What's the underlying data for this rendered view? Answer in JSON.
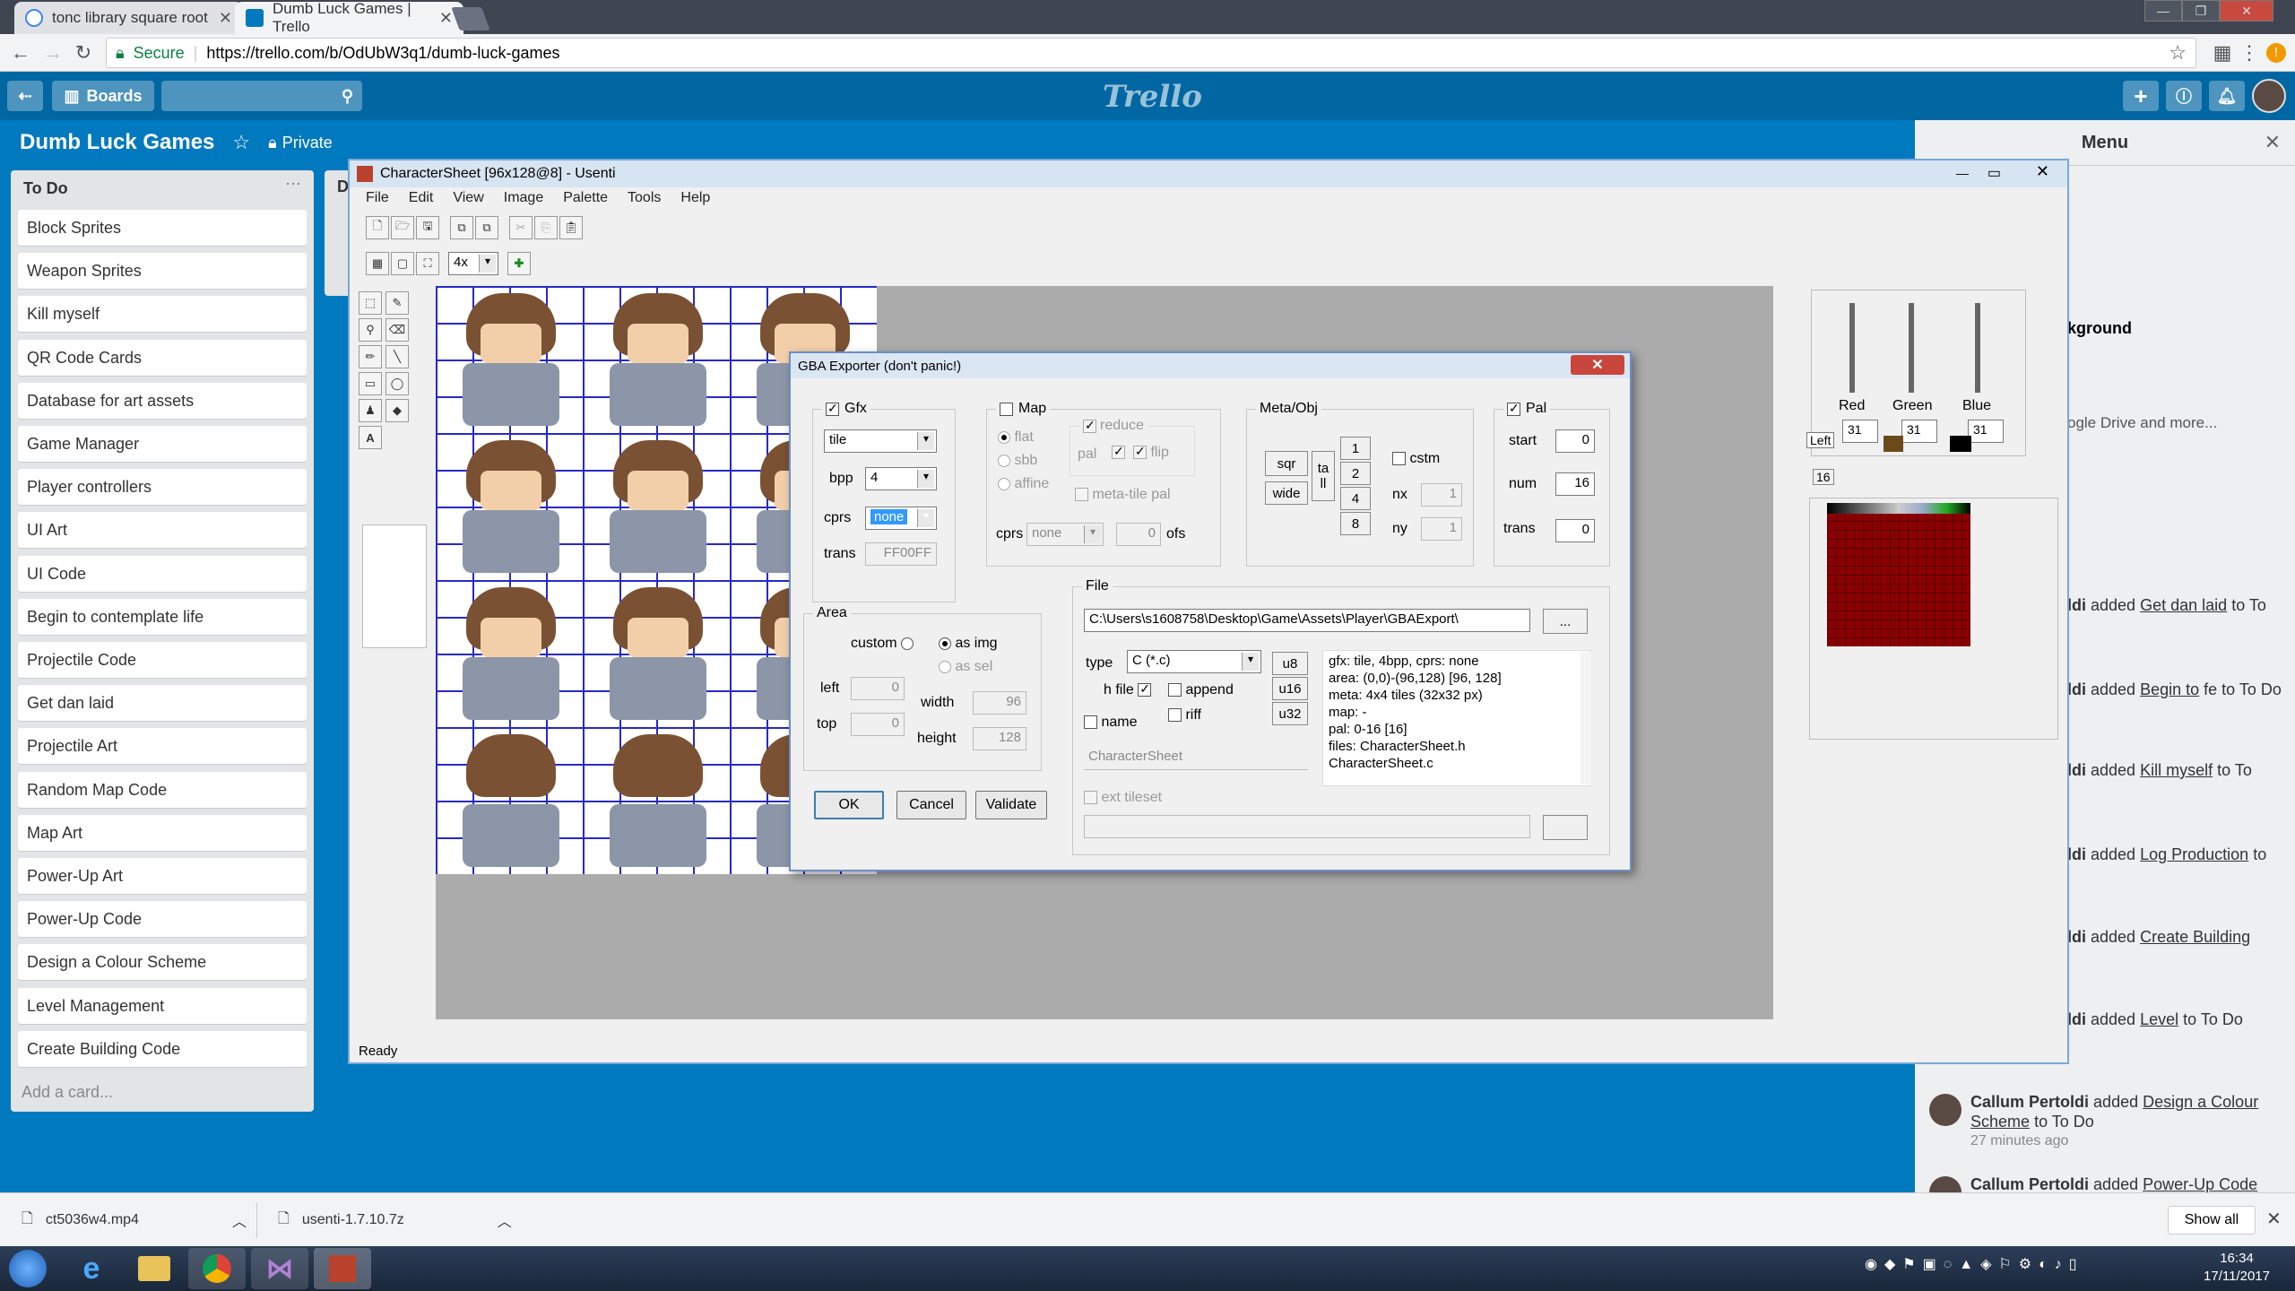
{
  "browser": {
    "tabs": [
      {
        "title": "tonc library square root",
        "active": false
      },
      {
        "title": "Dumb Luck Games | Trello",
        "active": true
      }
    ],
    "secure_label": "Secure",
    "url": "https://trello.com/b/OdUbW3q1/dumb-luck-games"
  },
  "trello": {
    "boards_label": "Boards",
    "logo": "Trello",
    "board_title": "Dumb Luck Games",
    "visibility": "Private",
    "list": {
      "title": "To Do",
      "cards": [
        "Block Sprites",
        "Weapon Sprites",
        "Kill myself",
        "QR Code Cards",
        "Database for art assets",
        "Game Manager",
        "Player controllers",
        "UI Art",
        "UI Code",
        "Begin to contemplate life",
        "Projectile Code",
        "Get dan laid",
        "Projectile Art",
        "Random Map Code",
        "Map Art",
        "Power-Up Art",
        "Power-Up Code",
        "Design a Colour Scheme",
        "Level Management",
        "Create Building Code"
      ],
      "add_card": "Add a card..."
    },
    "list2_initial": "D",
    "menu": {
      "title": "Menu",
      "background_frag": "kground",
      "drive_frag": "ogle Drive and more...",
      "activities": [
        {
          "who": "ldi",
          "verb": "added",
          "card": "Get dan laid",
          "rest": "to To"
        },
        {
          "who": "ldi",
          "verb": "added",
          "card": "Begin to",
          "rest": "fe to To Do"
        },
        {
          "who": "ldi",
          "verb": "added",
          "card": "Kill myself",
          "rest": "to To"
        },
        {
          "who": "ldi",
          "verb": "added",
          "card": "Log Production",
          "rest": "to"
        },
        {
          "who": "ldi",
          "verb": "added",
          "card": "Create Building",
          "rest": ""
        },
        {
          "who": "ldi",
          "verb": "added",
          "card": "Level",
          "rest": "to To Do"
        }
      ],
      "full_activities": [
        {
          "who": "Callum Pertoldi",
          "verb": "added",
          "card": "Design a Colour Scheme",
          "rest": "to To Do",
          "time": "27 minutes ago"
        },
        {
          "who": "Callum Pertoldi",
          "verb": "added",
          "card": "Power-Up Code",
          "rest": "",
          "time": ""
        }
      ]
    }
  },
  "usenti": {
    "title": "CharacterSheet [96x128@8] - Usenti",
    "menus": [
      "File",
      "Edit",
      "View",
      "Image",
      "Palette",
      "Tools",
      "Help"
    ],
    "zoom": "4x",
    "status": "Ready",
    "palette": {
      "labels": [
        "Red",
        "Green",
        "Blue"
      ],
      "values": [
        "31",
        "31",
        "31"
      ],
      "left_label": "Left",
      "count": "16"
    }
  },
  "gba": {
    "title": "GBA Exporter (don't panic!)",
    "gfx": {
      "label": "Gfx",
      "mode": "tile",
      "bpp_label": "bpp",
      "bpp": "4",
      "cprs_label": "cprs",
      "cprs": "none",
      "trans_label": "trans",
      "trans": "FF00FF"
    },
    "map": {
      "label": "Map",
      "flat": "flat",
      "sbb": "sbb",
      "affine": "affine",
      "reduce": "reduce",
      "pal": "pal",
      "flip": "flip",
      "metatile": "meta-tile pal",
      "cprs_label": "cprs",
      "cprs": "none",
      "ofs_val": "0",
      "ofs": "ofs"
    },
    "meta": {
      "label": "Meta/Obj",
      "sqr": "sqr",
      "wide": "wide",
      "tall_a": "ta",
      "tall_b": "ll",
      "sizes": [
        "1",
        "2",
        "4",
        "8"
      ],
      "cstm": "cstm",
      "nx": "nx",
      "nx_val": "1",
      "ny": "ny",
      "ny_val": "1"
    },
    "pal": {
      "label": "Pal",
      "start_label": "start",
      "start": "0",
      "num_label": "num",
      "num": "16",
      "trans_label": "trans",
      "trans": "0"
    },
    "area": {
      "label": "Area",
      "custom": "custom",
      "as_img": "as img",
      "as_sel": "as sel",
      "left_label": "left",
      "left": "0",
      "top_label": "top",
      "top": "0",
      "width_label": "width",
      "width": "96",
      "height_label": "height",
      "height": "128"
    },
    "file": {
      "label": "File",
      "path": "C:\\Users\\s1608758\\Desktop\\Game\\Assets\\Player\\GBAExport\\",
      "browse": "...",
      "type_label": "type",
      "type": "C (*.c)",
      "u8": "u8",
      "u16": "u16",
      "u32": "u32",
      "hfile": "h file",
      "append": "append",
      "riff": "riff",
      "name": "name",
      "name_value": "CharacterSheet",
      "ext_tileset": "ext tileset",
      "info": [
        "gfx: tile, 4bpp, cprs: none",
        "area: (0,0)-(96,128)  [96, 128]",
        "meta: 4x4 tiles (32x32 px)",
        "map: -",
        "pal: 0-16 [16]",
        "files:  CharacterSheet.h",
        "CharacterSheet.c"
      ]
    },
    "ok": "OK",
    "cancel": "Cancel",
    "validate": "Validate"
  },
  "downloads": {
    "items": [
      "ct5036w4.mp4",
      "usenti-1.7.10.7z"
    ],
    "show_all": "Show all"
  },
  "taskbar": {
    "time": "16:34",
    "date": "17/11/2017"
  }
}
